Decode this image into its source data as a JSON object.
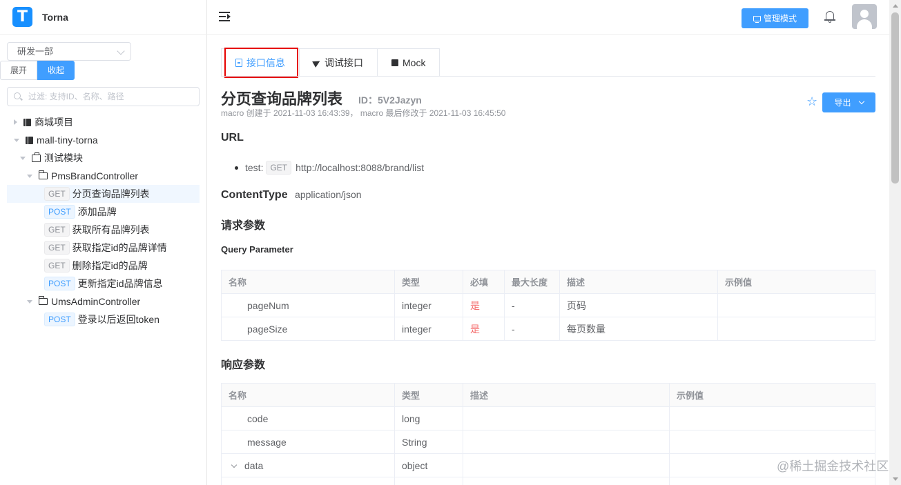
{
  "brand": {
    "logo_letter": "T",
    "name": "Torna"
  },
  "sidebar": {
    "space_select": "研发一部",
    "expand_label": "展开",
    "collapse_label": "收起",
    "filter_placeholder": "过滤: 支持ID、名称、路径",
    "tree": {
      "project1": "商城项目",
      "project2": "mall-tiny-torna",
      "module": "测试模块",
      "controller1": "PmsBrandController",
      "controller2": "UmsAdminController",
      "apis": [
        {
          "method": "GET",
          "label": "分页查询品牌列表"
        },
        {
          "method": "POST",
          "label": "添加品牌"
        },
        {
          "method": "GET",
          "label": "获取所有品牌列表"
        },
        {
          "method": "GET",
          "label": "获取指定id的品牌详情"
        },
        {
          "method": "GET",
          "label": "删除指定id的品牌"
        },
        {
          "method": "POST",
          "label": "更新指定id品牌信息"
        },
        {
          "method": "POST",
          "label": "登录以后返回token"
        }
      ]
    }
  },
  "header": {
    "admin_mode": "管理模式"
  },
  "tabs": [
    "接口信息",
    "调试接口",
    "Mock"
  ],
  "doc": {
    "title": "分页查询品牌列表",
    "id_label": "ID：5V2Jazyn",
    "meta": "macro 创建于 2021-11-03 16:43:39， macro 最后修改于 2021-11-03 16:45:50",
    "export_label": "导出",
    "url_heading": "URL",
    "url_env": "test:",
    "url_method": "GET",
    "url_value": "http://localhost:8088/brand/list",
    "content_type_label": "ContentType",
    "content_type_value": "application/json",
    "request_heading": "请求参数",
    "query_heading": "Query Parameter",
    "response_heading": "响应参数"
  },
  "request_table": {
    "headers": [
      "名称",
      "类型",
      "必填",
      "最大长度",
      "描述",
      "示例值"
    ],
    "rows": [
      [
        "pageNum",
        "integer",
        "是",
        "-",
        "页码",
        ""
      ],
      [
        "pageSize",
        "integer",
        "是",
        "-",
        "每页数量",
        ""
      ]
    ]
  },
  "response_table": {
    "headers": [
      "名称",
      "类型",
      "描述",
      "示例值"
    ],
    "rows": [
      [
        "code",
        "long",
        "",
        ""
      ],
      [
        "message",
        "String",
        "",
        ""
      ],
      [
        "data",
        "object",
        "",
        ""
      ]
    ]
  },
  "watermark": "@稀土掘金技术社区",
  "colors": {
    "primary": "#409eff",
    "danger": "#f56c6c",
    "highlight_box": "#e60000"
  }
}
